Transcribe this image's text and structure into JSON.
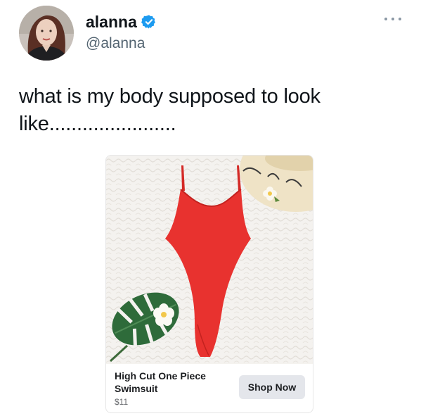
{
  "tweet": {
    "author": {
      "display_name": "alanna",
      "handle": "@alanna",
      "verified": true,
      "avatar_icon": "profile-photo"
    },
    "text": "what is my body supposed to look like.......................",
    "more_icon": "ellipsis-icon"
  },
  "ad_card": {
    "product_title": "High Cut One Piece Swimsuit",
    "price": "$11",
    "button_label": "Shop Now",
    "image_colors": {
      "swimsuit": "#e8322f",
      "leaf": "#2e6b3a",
      "background": "#f3f1ee"
    }
  },
  "colors": {
    "verified_badge": "#1d9bf0",
    "handle": "#536471",
    "button_bg": "#e4e6eb"
  }
}
